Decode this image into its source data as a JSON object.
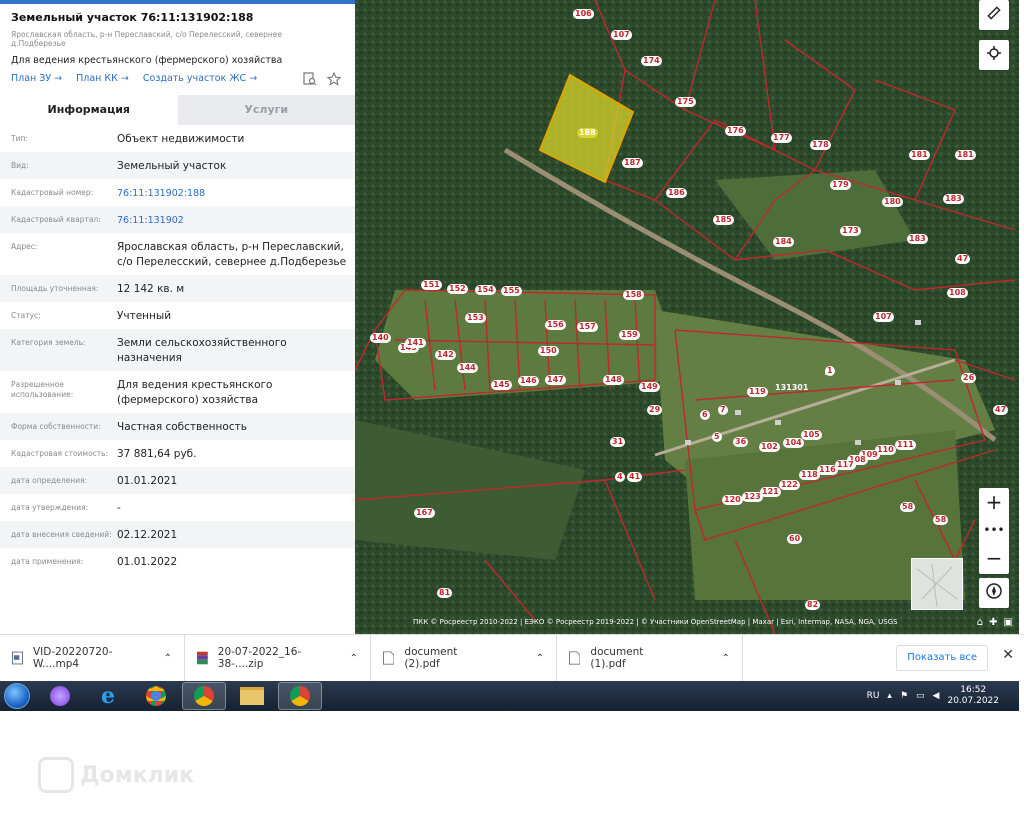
{
  "panel": {
    "title": "Земельный участок 76:11:131902:188",
    "subtitle": "Ярославская область, р-н Переславский, с/о Перелесский, севернее д.Подберезье",
    "purpose": "Для ведения крестьянского (фермерского) хозяйства",
    "links": [
      "План ЗУ →",
      "План КК →",
      "Создать участок ЖС →"
    ],
    "tabs": [
      {
        "label": "Информация",
        "active": true
      },
      {
        "label": "Услуги",
        "active": false
      }
    ],
    "rows": [
      {
        "label": "Тип:",
        "value": "Объект недвижимости"
      },
      {
        "label": "Вид:",
        "value": "Земельный участок"
      },
      {
        "label": "Кадастровый номер:",
        "value": "76:11:131902:188",
        "link": true
      },
      {
        "label": "Кадастровый квартал:",
        "value": "76:11:131902",
        "link": true
      },
      {
        "label": "Адрес:",
        "value": "Ярославская область, р-н Переславский, с/о Перелесский, севернее д.Подберезье"
      },
      {
        "label": "Площадь уточненная:",
        "value": "12 142 кв. м"
      },
      {
        "label": "Статус:",
        "value": "Учтенный"
      },
      {
        "label": "Категория земель:",
        "value": "Земли сельскохозяйственного назначения"
      },
      {
        "label": "Разрешенное использование:",
        "value": "Для ведения крестьянского (фермерского) хозяйства"
      },
      {
        "label": "Форма собственности:",
        "value": "Частная собственность"
      },
      {
        "label": "Кадастровая стоимость:",
        "value": "37 881,64 руб."
      },
      {
        "label": "дата определения:",
        "value": "01.01.2021"
      },
      {
        "label": "дата утверждения:",
        "value": "-"
      },
      {
        "label": "дата внесения сведений:",
        "value": "02.12.2021"
      },
      {
        "label": "дата применения:",
        "value": "01.01.2022"
      }
    ]
  },
  "map": {
    "selected_plot": "188",
    "quarter_label": "131301",
    "plot_labels": [
      "172",
      "189",
      "174",
      "175",
      "176",
      "177",
      "178",
      "181",
      "181",
      "179",
      "180",
      "183",
      "187",
      "186",
      "185",
      "184",
      "173",
      "183",
      "47",
      "108",
      "107",
      "150",
      "151",
      "152",
      "153",
      "154",
      "155",
      "156",
      "157",
      "158",
      "159",
      "143",
      "140",
      "141",
      "142",
      "144",
      "145",
      "146",
      "147",
      "148",
      "149",
      "29",
      "41",
      "167",
      "81",
      "82",
      "60",
      "58",
      "58",
      "26",
      "47",
      "111",
      "110",
      "109",
      "108",
      "117",
      "116",
      "118",
      "122",
      "121",
      "123",
      "120",
      "119",
      "1",
      "6",
      "7",
      "31",
      "4",
      "5",
      "36",
      "102",
      "104",
      "105",
      "106",
      "107"
    ],
    "attribution": "ПКК © Росреестр 2010-2022 | ЕЭКО © Росреестр 2019-2022 | © Участники OpenStreetMap | Maxar | Esri, Intermap, NASA, NGA, USGS"
  },
  "downloads": {
    "items": [
      {
        "name": "VID-20220720-W....mp4",
        "icon": "video-file-icon"
      },
      {
        "name": "20-07-2022_16-38-....zip",
        "icon": "archive-file-icon"
      },
      {
        "name": "document (2).pdf",
        "icon": "pdf-file-icon"
      },
      {
        "name": "document (1).pdf",
        "icon": "pdf-file-icon"
      }
    ],
    "show_all": "Показать все"
  },
  "taskbar": {
    "lang": "RU",
    "time": "16:52",
    "date": "20.07.2022"
  },
  "watermark": "Домклик"
}
